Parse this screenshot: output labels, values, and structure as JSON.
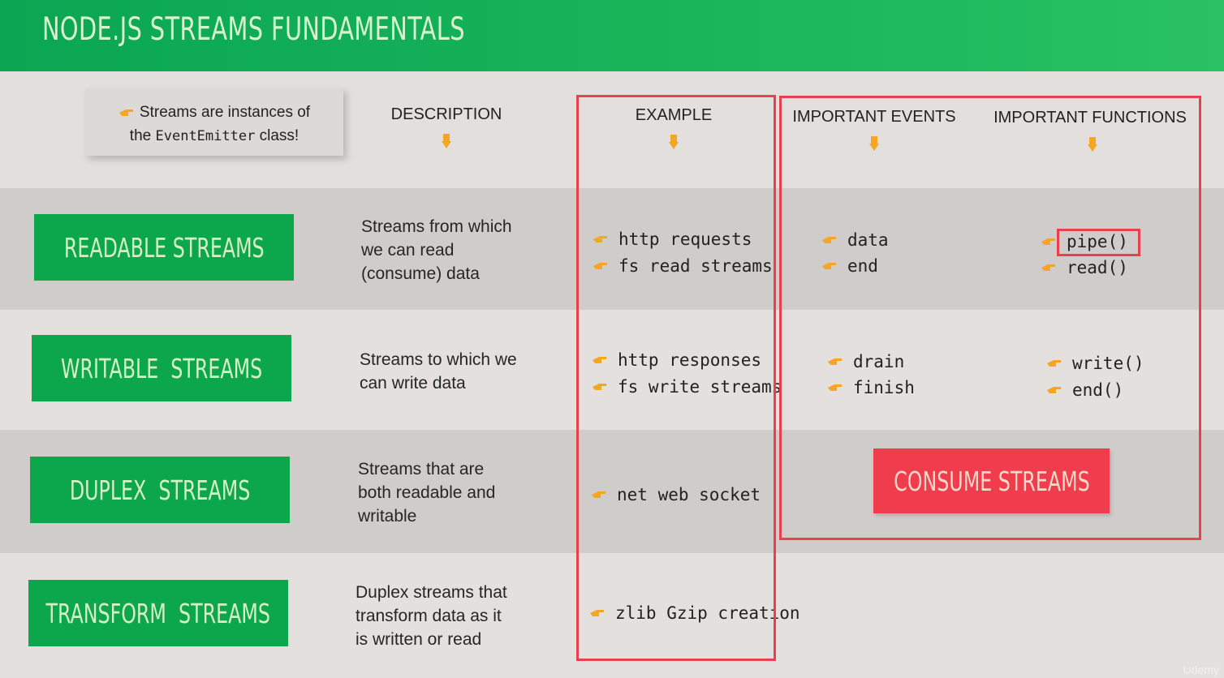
{
  "header": {
    "title": "NODE.JS STREAMS FUNDAMENTALS"
  },
  "note": {
    "line1": "Streams are instances of",
    "line2_pre": "the ",
    "line2_code": "EventEmitter",
    "line2_post": " class!"
  },
  "columns": {
    "description": "DESCRIPTION",
    "example": "EXAMPLE",
    "events": "IMPORTANT EVENTS",
    "functions": "IMPORTANT FUNCTIONS"
  },
  "rows": [
    {
      "name": "READABLE STREAMS",
      "desc": [
        "Streams from which",
        "we can read",
        "(consume) data"
      ],
      "examples": [
        "http requests",
        "fs read streams"
      ],
      "events": [
        "data",
        "end"
      ],
      "functions": [
        "pipe()",
        "read()"
      ]
    },
    {
      "name": "WRITABLE  STREAMS",
      "desc": [
        "Streams to which we",
        "can write data"
      ],
      "examples": [
        "http responses",
        "fs write streams"
      ],
      "events": [
        "drain",
        "finish"
      ],
      "functions": [
        "write()",
        "end()"
      ]
    },
    {
      "name": "DUPLEX  STREAMS",
      "desc": [
        "Streams that are",
        "both readable and",
        "writable"
      ],
      "examples": [
        "net web socket"
      ]
    },
    {
      "name": "TRANSFORM  STREAMS",
      "desc": [
        "Duplex streams that",
        "transform data as it",
        "is written or read"
      ],
      "examples": [
        "zlib Gzip creation"
      ]
    }
  ],
  "consume_button": "CONSUME STREAMS",
  "watermark": "Udemy",
  "colors": {
    "header_green": "#0aa653",
    "stream_green": "#0ca64d",
    "accent_red": "#e8404f",
    "hand_orange": "#f5a623"
  }
}
